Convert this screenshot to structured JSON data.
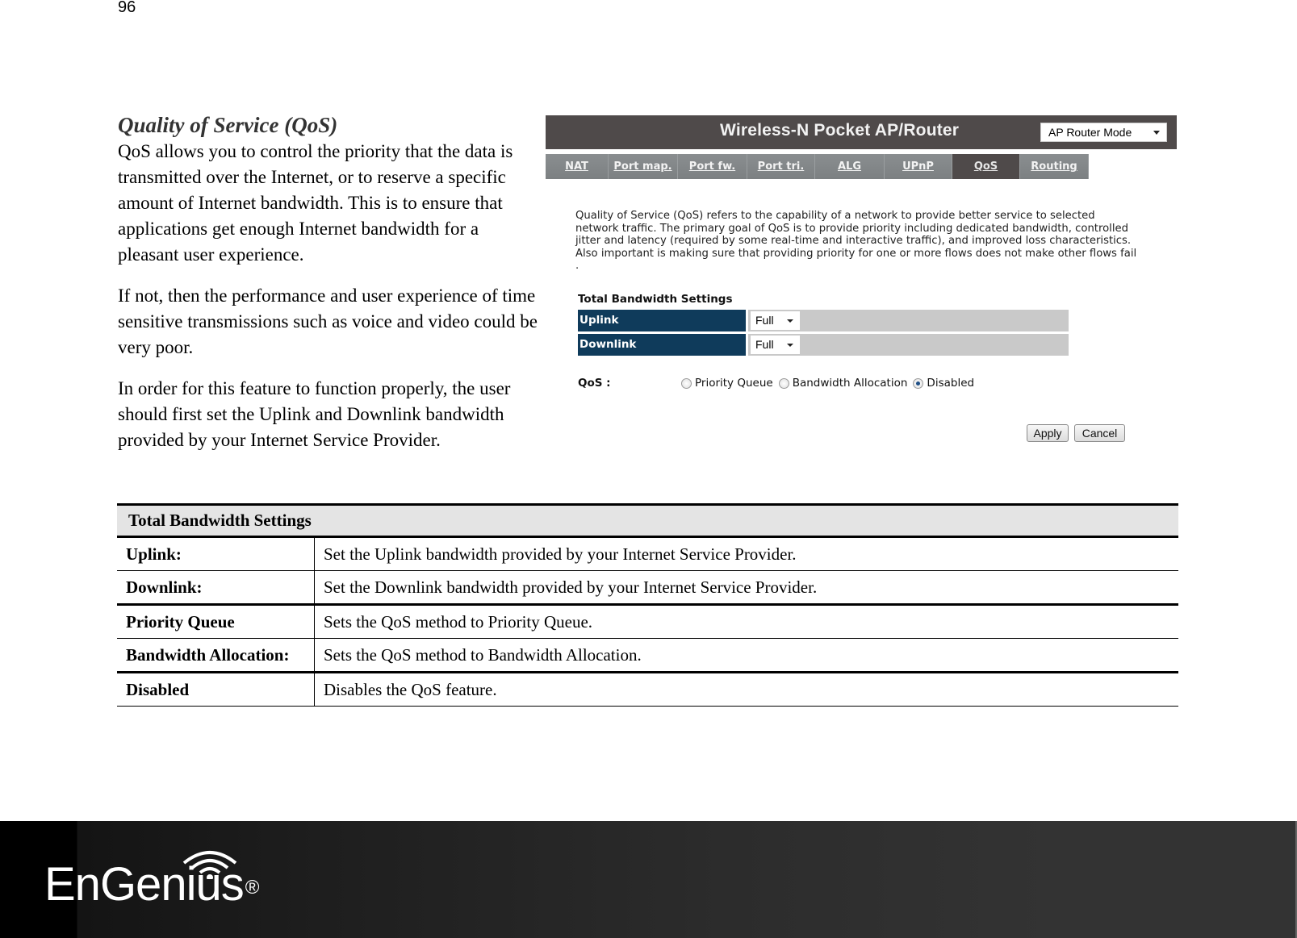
{
  "page_number": "96",
  "section": {
    "title": "Quality of Service (QoS)",
    "paragraphs": [
      "QoS allows you to control the priority that the data is transmitted over the Internet, or to reserve a specific amount of Internet bandwidth. This is to ensure that applications get enough Internet bandwidth for a pleasant user experience.",
      "If not, then the performance and user experience of time sensitive transmissions such as voice and video could be very poor.",
      "In order for this feature to function properly, the user should first set the Uplink and Downlink bandwidth provided by your Internet Service Provider."
    ]
  },
  "router_ui": {
    "title": "Wireless-N Pocket AP/Router",
    "mode_select": "AP Router Mode",
    "tabs": [
      {
        "label": "NAT",
        "active": false
      },
      {
        "label": "Port map.",
        "active": false
      },
      {
        "label": "Port fw.",
        "active": false
      },
      {
        "label": "Port tri.",
        "active": false
      },
      {
        "label": "ALG",
        "active": false
      },
      {
        "label": "UPnP",
        "active": false
      },
      {
        "label": "QoS",
        "active": true
      },
      {
        "label": "Routing",
        "active": false
      }
    ],
    "description": "Quality of Service (QoS) refers to the capability of a network to provide better service to selected network traffic. The primary goal of QoS is to provide priority including dedicated bandwidth, controlled jitter and latency (required by some real-time and interactive traffic), and improved loss characteristics. Also important is making sure that providing priority for one or more flows does not make other flows fail .",
    "bandwidth_title": "Total Bandwidth Settings",
    "uplink": {
      "label": "Uplink",
      "value": "Full"
    },
    "downlink": {
      "label": "Downlink",
      "value": "Full"
    },
    "qos_label": "QoS :",
    "qos_options": [
      {
        "label": "Priority Queue",
        "checked": false
      },
      {
        "label": "Bandwidth Allocation",
        "checked": false
      },
      {
        "label": "Disabled",
        "checked": true
      }
    ],
    "apply_label": "Apply",
    "cancel_label": "Cancel"
  },
  "table": {
    "header": "Total Bandwidth Settings",
    "rows": [
      {
        "term": "Uplink:",
        "desc": "Set the Uplink bandwidth provided by your Internet Service Provider."
      },
      {
        "term": "Downlink:",
        "desc": "Set the Downlink bandwidth provided by your Internet Service Provider."
      },
      {
        "term": "Priority Queue",
        "desc": "Sets the QoS method to Priority Queue."
      },
      {
        "term": "Bandwidth Allocation:",
        "desc": "Sets the QoS method to Bandwidth Allocation."
      },
      {
        "term": "Disabled",
        "desc": "Disables the QoS feature."
      }
    ]
  },
  "footer": {
    "logo_text": "EnGenius",
    "registered_mark": "®"
  }
}
